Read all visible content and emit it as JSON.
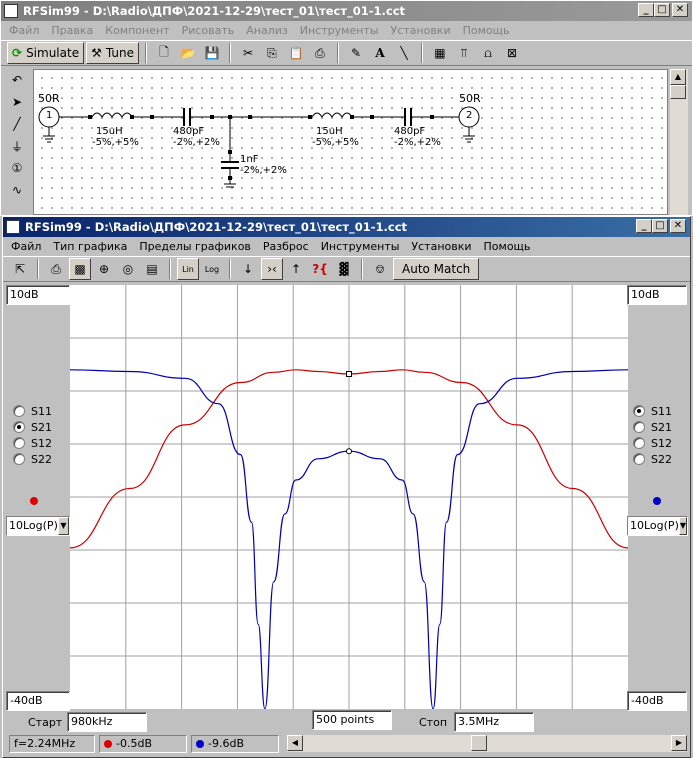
{
  "main_window": {
    "title": "RFSim99 - D:\\Radio\\ДПФ\\2021-12-29\\тест_01\\тест_01-1.cct",
    "menu": [
      "Файл",
      "Правка",
      "Компонент",
      "Рисовать",
      "Анализ",
      "Инструменты",
      "Установки",
      "Помощь"
    ],
    "toolbar": {
      "simulate_label": "Simulate",
      "tune_label": "Tune"
    }
  },
  "schematic": {
    "port1": {
      "name": "50R",
      "number": "1"
    },
    "port2": {
      "name": "50R",
      "number": "2"
    },
    "components": [
      {
        "id": "L1",
        "value": "15uH",
        "tol": "-5%,+5%"
      },
      {
        "id": "C1",
        "value": "480pF",
        "tol": "-2%,+2%"
      },
      {
        "id": "C2",
        "value": "1nF",
        "tol": "-2%,+2%"
      },
      {
        "id": "L2",
        "value": "15uH",
        "tol": "-5%,+5%"
      },
      {
        "id": "C3",
        "value": "480pF",
        "tol": "-2%,+2%"
      }
    ]
  },
  "graph_window": {
    "title": "RFSim99 - D:\\Radio\\ДПФ\\2021-12-29\\тест_01\\тест_01-1.cct",
    "menu": [
      "Файл",
      "Тип графика",
      "Пределы графиков",
      "Разброс",
      "Инструменты",
      "Установки",
      "Помощь"
    ],
    "toolbar": {
      "auto_match_label": "Auto Match"
    },
    "left_panel": {
      "top_limit": "10dB",
      "bottom_limit": "-40dB",
      "scale_select": "10Log(P)",
      "trace_color": "#e00000",
      "params": [
        {
          "label": "S11",
          "selected": false
        },
        {
          "label": "S21",
          "selected": true
        },
        {
          "label": "S12",
          "selected": false
        },
        {
          "label": "S22",
          "selected": false
        }
      ]
    },
    "right_panel": {
      "top_limit": "10dB",
      "bottom_limit": "-40dB",
      "scale_select": "10Log(P)",
      "trace_color": "#0000c8",
      "params": [
        {
          "label": "S11",
          "selected": true
        },
        {
          "label": "S21",
          "selected": false
        },
        {
          "label": "S12",
          "selected": false
        },
        {
          "label": "S22",
          "selected": false
        }
      ]
    },
    "bottom": {
      "start_label": "Старт",
      "start_value": "980kHz",
      "points_value": "500 points",
      "stop_label": "Стоп",
      "stop_value": "3.5MHz"
    },
    "status": {
      "frequency": "f=2.24MHz",
      "left_value": "-0.5dB",
      "right_value": "-9.6dB"
    }
  },
  "chart_data": {
    "type": "line",
    "xlim": [
      980,
      3500
    ],
    "x_unit": "kHz",
    "grid": true,
    "marker_x": 2240,
    "series": [
      {
        "color": "#cc0000",
        "axis": "left",
        "ylim": [
          -40,
          10
        ],
        "x": [
          980,
          1250,
          1500,
          1750,
          1900,
          2000,
          2100,
          2240,
          2380,
          2480,
          2580,
          2750,
          3000,
          3250,
          3500
        ],
        "y": [
          -21,
          -14,
          -6.5,
          -1.5,
          -0.3,
          0,
          -0.2,
          -0.5,
          -0.2,
          0,
          -0.3,
          -1.5,
          -6.5,
          -14,
          -21
        ]
      },
      {
        "color": "#0000aa",
        "axis": "right",
        "ylim": [
          -40,
          10
        ],
        "x": [
          980,
          1250,
          1500,
          1650,
          1750,
          1800,
          1830,
          1860,
          1900,
          1950,
          2000,
          2100,
          2240,
          2380,
          2480,
          2530,
          2580,
          2620,
          2650,
          2680,
          2730,
          2830,
          3000,
          3250,
          3500
        ],
        "y": [
          0,
          -0.2,
          -1,
          -4,
          -10,
          -18,
          -30,
          -40,
          -25,
          -17,
          -13,
          -10.5,
          -9.6,
          -10.5,
          -13,
          -17,
          -25,
          -40,
          -30,
          -18,
          -10,
          -4,
          -1,
          -0.2,
          0
        ]
      }
    ]
  }
}
